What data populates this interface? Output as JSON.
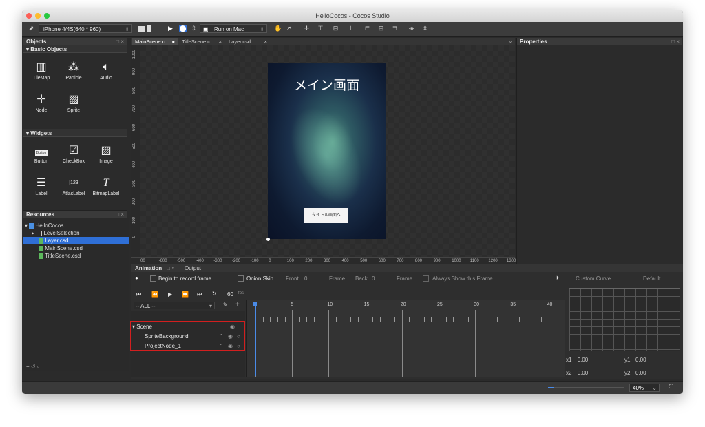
{
  "window": {
    "title": "HelloCocos - Cocos Studio"
  },
  "toolbar": {
    "device": "iPhone 4/4S(640 * 960)",
    "run_target": "Run on Mac"
  },
  "objects_panel": {
    "title": "Objects",
    "basic_title": "Basic Objects",
    "basic_items": [
      "TileMap",
      "Particle",
      "Audio",
      "Node",
      "Sprite"
    ],
    "widgets_title": "Widgets",
    "widget_items": [
      "Button",
      "CheckBox",
      "Image",
      "Label",
      "AtlasLabel",
      "BitmapLabel"
    ],
    "button_icon_text": "Button",
    "atlas_icon_text": "123"
  },
  "resources_panel": {
    "title": "Resources",
    "items": [
      "HelloCocos",
      "LevelSelection",
      "Layer.csd",
      "MainScene.csd",
      "TitleScene.csd"
    ]
  },
  "editor_tabs": [
    "MainScene.c",
    "TitleScene.c",
    "Layer.csd"
  ],
  "canvas": {
    "scene_title": "メイン画面",
    "scene_button": "タイトル画面へ",
    "x_ticks": [
      "00",
      "-600",
      "-500",
      "-400",
      "-300",
      "-200",
      "-100",
      "0",
      "100",
      "200",
      "300",
      "400",
      "500",
      "600",
      "700",
      "800",
      "900",
      "1000",
      "1100",
      "1200",
      "1300"
    ],
    "y_ticks": [
      "1000",
      "900",
      "800",
      "700",
      "600",
      "500",
      "400",
      "300",
      "200",
      "100",
      "0"
    ]
  },
  "properties_panel": {
    "title": "Properties"
  },
  "animation": {
    "tab_animation": "Animation",
    "tab_output": "Output",
    "record_label": "Begin to record frame",
    "onion_skin": "Onion Skin",
    "front_label": "Front",
    "front_value": "0",
    "frame_label": "Frame",
    "back_label": "Back",
    "back_value": "0",
    "frame_label2": "Frame",
    "always_show": "Always Show this Frame",
    "custom_curve": "Custom Curve",
    "default_label": "Default",
    "fps_value": "60",
    "fps_unit": "fps",
    "filter": "-- ALL --",
    "timeline_numbers": [
      "0",
      "5",
      "10",
      "15",
      "20",
      "25",
      "30",
      "35",
      "40"
    ],
    "tree": [
      {
        "label": "Scene"
      },
      {
        "label": "SpriteBackground"
      },
      {
        "label": "ProjectNode_1"
      }
    ],
    "curve": {
      "x1_label": "x1",
      "x1": "0.00",
      "y1_label": "y1",
      "y1": "0.00",
      "x2_label": "x2",
      "x2": "0.00",
      "y2_label": "y2",
      "y2": "0.00"
    }
  },
  "status": {
    "zoom": "40%"
  },
  "colors": {
    "accent": "#2f6fd6",
    "highlight_box": "#d21f1f"
  }
}
